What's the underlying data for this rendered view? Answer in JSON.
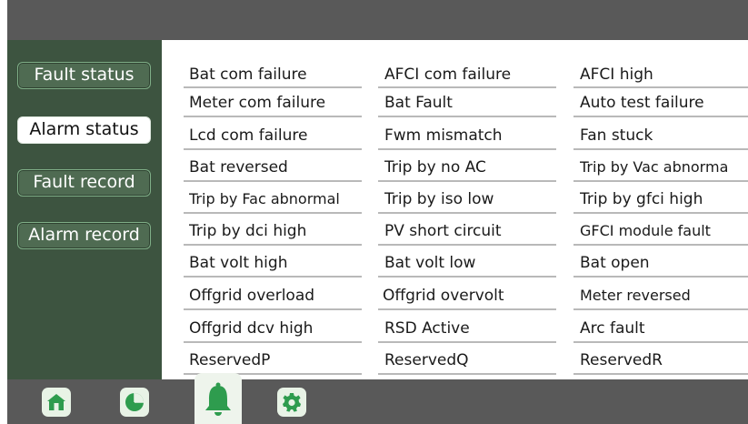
{
  "sidebar": {
    "items": [
      {
        "label": "Fault status",
        "active": false
      },
      {
        "label": "Alarm status",
        "active": true
      },
      {
        "label": "Fault record",
        "active": false
      },
      {
        "label": "Alarm record",
        "active": false
      }
    ]
  },
  "alarms": {
    "rows": [
      [
        "Bat com failure",
        "AFCI com failure",
        "AFCI high"
      ],
      [
        "Meter com failure",
        "Bat Fault",
        "Auto test failure"
      ],
      [
        "Lcd com failure",
        "Fwm mismatch",
        "Fan stuck"
      ],
      [
        "Bat reversed",
        "Trip by no AC",
        "Trip by Vac abnorma"
      ],
      [
        "Trip by Fac abnormal",
        "Trip by iso low",
        "Trip by gfci high"
      ],
      [
        "Trip by dci high",
        "PV short circuit",
        "GFCI module fault"
      ],
      [
        "Bat volt high",
        "Bat volt low",
        "Bat open"
      ],
      [
        "Offgrid overload",
        "Offgrid overvolt",
        "Meter reversed"
      ],
      [
        "Offgrid dcv high",
        "RSD Active",
        "Arc fault"
      ],
      [
        "ReservedP",
        "ReservedQ",
        "ReservedR"
      ]
    ]
  },
  "nav": {
    "items": [
      {
        "icon": "home-icon"
      },
      {
        "icon": "pie-chart-icon"
      },
      {
        "icon": "bell-icon",
        "active": true
      },
      {
        "icon": "gear-icon"
      }
    ]
  },
  "colors": {
    "sidebar_bg": "#3d5440",
    "button_border": "#7fae87",
    "bar_bg": "#595959",
    "icon_green": "#2e9c4e"
  }
}
